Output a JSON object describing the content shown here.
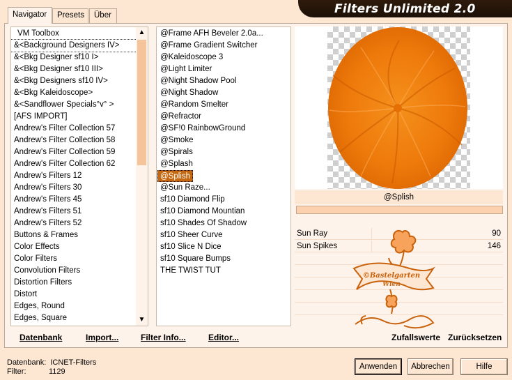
{
  "tabs": [
    {
      "label": "Navigator"
    },
    {
      "label": "Presets"
    },
    {
      "label": "Über"
    }
  ],
  "app_title": "Filters Unlimited 2.0",
  "categories": [
    "VM Toolbox",
    "&<Background Designers IV>",
    "&<Bkg Designer sf10 I>",
    "&<Bkg Designer sf10 III>",
    "&<Bkg Designers sf10 IV>",
    "&<Bkg Kaleidoscope>",
    "&<Sandflower Specials°v° >",
    "[AFS IMPORT]",
    "Andrew's Filter Collection 57",
    "Andrew's Filter Collection 58",
    "Andrew's Filter Collection 59",
    "Andrew's Filter Collection 62",
    "Andrew's Filters 12",
    "Andrew's Filters 30",
    "Andrew's Filters 45",
    "Andrew's Filters 51",
    "Andrew's Filters 52",
    "Buttons & Frames",
    "Color Effects",
    "Color Filters",
    "Convolution Filters",
    "Distortion Filters",
    "Distort",
    "Edges, Round",
    "Edges, Square"
  ],
  "filters": [
    "@Frame AFH Beveler 2.0a...",
    "@Frame Gradient Switcher",
    "@Kaleidoscope 3",
    "@Light Limiter",
    "@Night Shadow Pool",
    "@Night Shadow",
    "@Random Smelter",
    "@Refractor",
    "@SF!0 RainbowGround",
    "@Smoke",
    "@Spirals",
    "@Splash",
    "@Splish",
    "@Sun Raze...",
    "sf10 Diamond Flip",
    "sf10 Diamond Mountian",
    "sf10 Shades Of Shadow",
    "sf10 Sheer Curve",
    "sf10 Slice N Dice",
    "sf10 Square Bumps",
    "THE TWIST TUT"
  ],
  "selected_filter_index": 12,
  "selected_category_index": 1,
  "bottom_buttons": {
    "database": "Datenbank",
    "import": "Import...",
    "filter_info": "Filter Info...",
    "editor": "Editor..."
  },
  "current_filter_name": "@Splish",
  "params": [
    {
      "label": "Sun Ray",
      "value": "90"
    },
    {
      "label": "Sun Spikes",
      "value": "146"
    }
  ],
  "param_actions": {
    "random": "Zufallswerte",
    "reset": "Zurücksetzen"
  },
  "watermark": {
    "line1": "©Bastelgarten",
    "line2": "Wien"
  },
  "status": {
    "db_label": "Datenbank:",
    "db_value": "ICNET-Filters",
    "filter_label": "Filter:",
    "filter_value": "1129"
  },
  "buttons": {
    "apply": "Anwenden",
    "cancel": "Abbrechen",
    "help": "Hilfe"
  },
  "colors": {
    "accent": "#c5670f",
    "preview_orange": "#f07a0c",
    "banner": "#2e1b0c"
  }
}
